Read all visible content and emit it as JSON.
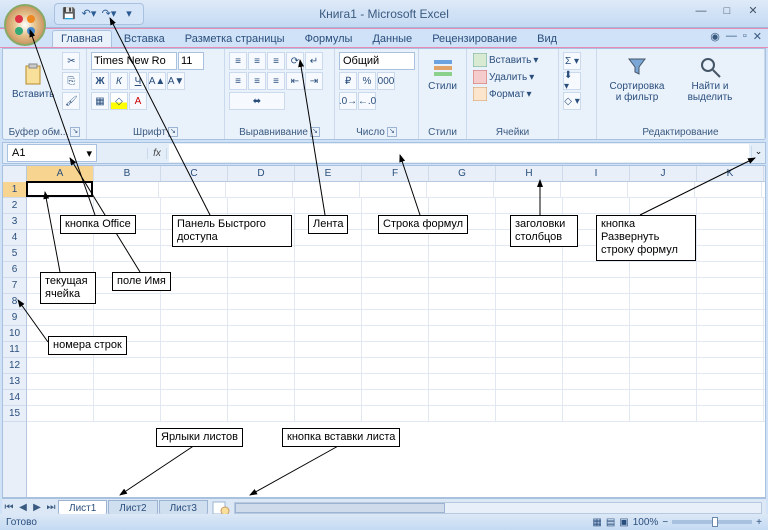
{
  "title": "Книга1 - Microsoft Excel",
  "qat": {
    "save": "save",
    "undo": "undo",
    "redo": "redo"
  },
  "tabs": {
    "items": [
      "Главная",
      "Вставка",
      "Разметка страницы",
      "Формулы",
      "Данные",
      "Рецензирование",
      "Вид"
    ],
    "active_index": 0
  },
  "ribbon": {
    "clipboard": {
      "label": "Буфер обм...",
      "paste": "Вставить"
    },
    "font": {
      "label": "Шрифт",
      "name": "Times New Ro",
      "size": "11"
    },
    "alignment": {
      "label": "Выравнивание"
    },
    "number": {
      "label": "Число",
      "format": "Общий"
    },
    "styles": {
      "label": "Стили",
      "styles_btn": "Стили"
    },
    "cells": {
      "label": "Ячейки",
      "insert": "Вставить",
      "delete": "Удалить",
      "format": "Формат"
    },
    "editing": {
      "label": "Редактирование",
      "sort": "Сортировка и фильтр",
      "find": "Найти и выделить"
    }
  },
  "namebox": "A1",
  "columns": [
    "A",
    "B",
    "C",
    "D",
    "E",
    "F",
    "G",
    "H",
    "I",
    "J",
    "K"
  ],
  "rows": [
    1,
    2,
    3,
    4,
    5,
    6,
    7,
    8,
    9,
    10,
    11,
    12,
    13,
    14,
    15
  ],
  "sheets": {
    "items": [
      "Лист1",
      "Лист2",
      "Лист3"
    ],
    "active_index": 0
  },
  "status": {
    "ready": "Готово",
    "zoom": "100%"
  },
  "annotations": {
    "office": "кнопка Office",
    "qat": "Панель Быстрого доступа",
    "ribbon": "Лента",
    "formula": "Строка формул",
    "colheads": "заголовки столбцов",
    "expand": "кнопка Развернуть строку формул",
    "activecell": "текущая ячейка",
    "namebox": "поле Имя",
    "rownums": "номера строк",
    "sheettabs": "Ярлыки листов",
    "insertsheet": "кнопка вставки листа"
  }
}
